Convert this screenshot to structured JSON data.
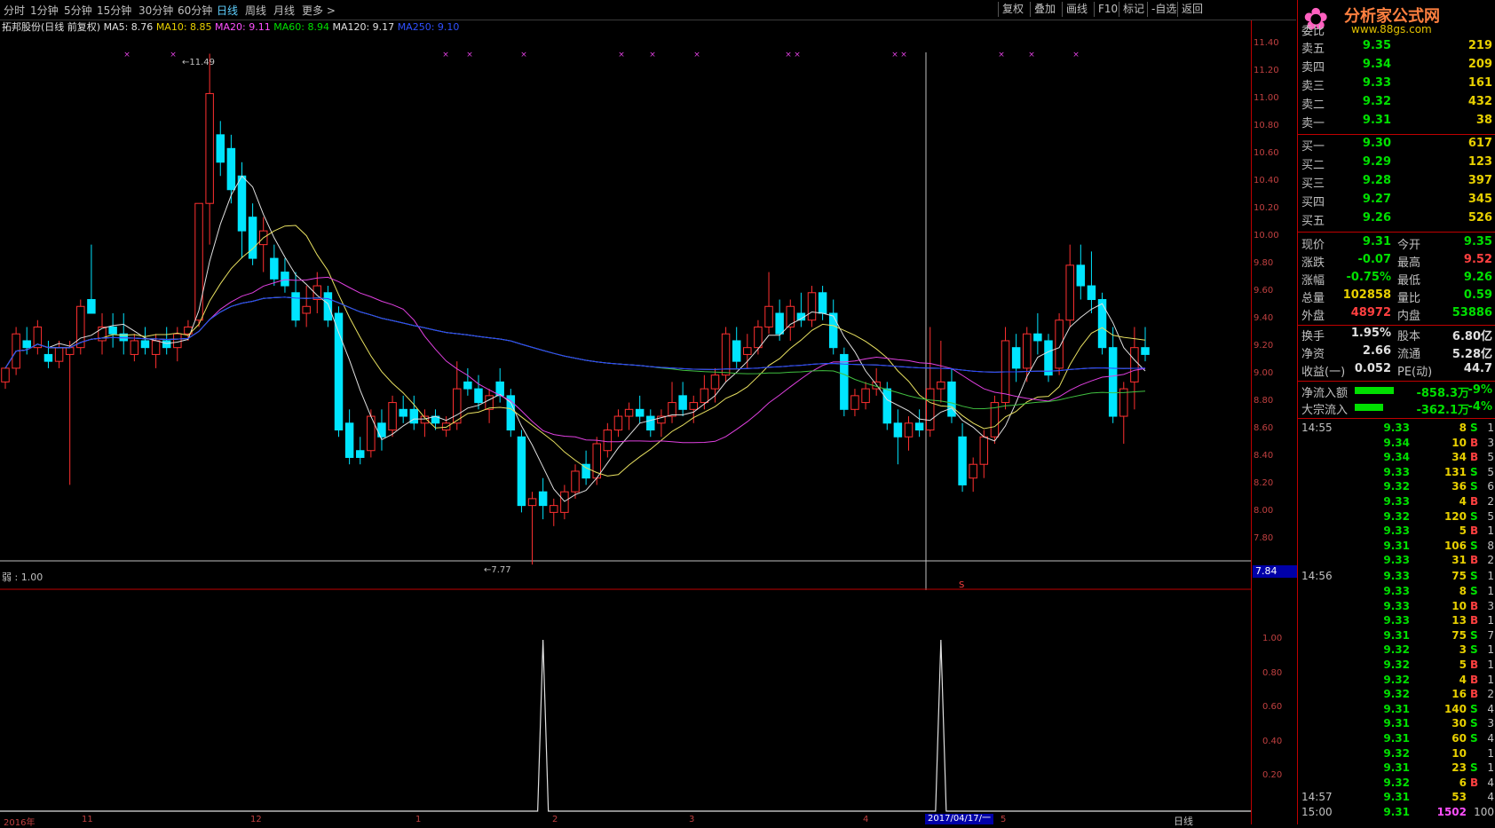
{
  "toolbar": {
    "periods": [
      "分时",
      "1分钟",
      "5分钟",
      "15分钟",
      "30分钟",
      "60分钟",
      "日线",
      "周线",
      "月线",
      "更多 >"
    ],
    "active_period": "日线",
    "buttons": [
      "复权",
      "叠加",
      "画线",
      "F10",
      "标记",
      "-自选",
      "返回"
    ]
  },
  "indicator_header": {
    "stock": "拓邦股份(日线 前复权)",
    "ma5": "MA5: 8.76",
    "ma10": "MA10: 8.85",
    "ma20": "MA20: 9.11",
    "ma60": "MA60: 8.94",
    "ma120": "MA120: 9.17",
    "ma250": "MA250: 9.10"
  },
  "colors": {
    "up": "#ff3030",
    "down": "#00e5ff",
    "ma5": "#e0e0e0",
    "ma10": "#e8e060",
    "ma20": "#e040e0",
    "ma60": "#40c040",
    "ma120": "#d0d0d0",
    "ma250": "#2040ff"
  },
  "main_axis": [
    "11.40",
    "11.20",
    "11.00",
    "10.80",
    "10.60",
    "10.40",
    "10.20",
    "10.00",
    "9.80",
    "9.60",
    "9.40",
    "9.20",
    "9.00",
    "8.80",
    "8.60",
    "8.40",
    "8.20",
    "8.00",
    "7.80"
  ],
  "current_price_box": "7.84",
  "high_label": "11.49",
  "low_label": "7.77",
  "sub_label": "弱 : 1.00",
  "sub_axis": [
    "1.00",
    "0.80",
    "0.60",
    "0.40",
    "0.20"
  ],
  "s_marker": "S",
  "date_labels": [
    "2016年",
    "11",
    "12",
    "1",
    "2",
    "3",
    "4",
    "5"
  ],
  "cursor_date": "2017/04/17/一",
  "bottom_right_label": "日线",
  "logo": {
    "title": "分析家公式网",
    "url": "www.88gs.com"
  },
  "order_book": {
    "header": "委比",
    "asks": [
      {
        "label": "卖五",
        "price": "9.35",
        "vol": "219"
      },
      {
        "label": "卖四",
        "price": "9.34",
        "vol": "209"
      },
      {
        "label": "卖三",
        "price": "9.33",
        "vol": "161"
      },
      {
        "label": "卖二",
        "price": "9.32",
        "vol": "432"
      },
      {
        "label": "卖一",
        "price": "9.31",
        "vol": "38"
      }
    ],
    "bids": [
      {
        "label": "买一",
        "price": "9.30",
        "vol": "617"
      },
      {
        "label": "买二",
        "price": "9.29",
        "vol": "123"
      },
      {
        "label": "买三",
        "price": "9.28",
        "vol": "397"
      },
      {
        "label": "买四",
        "price": "9.27",
        "vol": "345"
      },
      {
        "label": "买五",
        "price": "9.26",
        "vol": "526"
      }
    ]
  },
  "quote": [
    {
      "l1": "现价",
      "v1": "9.31",
      "c1": "green",
      "l2": "今开",
      "v2": "9.35",
      "c2": "green"
    },
    {
      "l1": "涨跌",
      "v1": "-0.07",
      "c1": "green",
      "l2": "最高",
      "v2": "9.52",
      "c2": "red"
    },
    {
      "l1": "涨幅",
      "v1": "-0.75%",
      "c1": "green",
      "l2": "最低",
      "v2": "9.26",
      "c2": "green"
    },
    {
      "l1": "总量",
      "v1": "102858",
      "c1": "yellow",
      "l2": "量比",
      "v2": "0.59",
      "c2": "green"
    },
    {
      "l1": "外盘",
      "v1": "48972",
      "c1": "red",
      "l2": "内盘",
      "v2": "53886",
      "c2": "green"
    },
    {
      "l1": "换手",
      "v1": "1.95%",
      "c1": "white",
      "l2": "股本",
      "v2": "6.80亿",
      "c2": "white"
    },
    {
      "l1": "净资",
      "v1": "2.66",
      "c1": "white",
      "l2": "流通",
      "v2": "5.28亿",
      "c2": "white"
    },
    {
      "l1": "收益(一)",
      "v1": "0.052",
      "c1": "white",
      "l2": "PE(动)",
      "v2": "44.7",
      "c2": "white"
    }
  ],
  "flows": [
    {
      "label": "净流入额",
      "value": "-858.3万",
      "pct": "-9%"
    },
    {
      "label": "大宗流入",
      "value": "-362.1万",
      "pct": "-4%"
    }
  ],
  "ticks": [
    {
      "time": "14:55",
      "price": "9.33",
      "vol": "8",
      "side": "S",
      "n": "1"
    },
    {
      "time": "",
      "price": "9.34",
      "vol": "10",
      "side": "B",
      "n": "3"
    },
    {
      "time": "",
      "price": "9.34",
      "vol": "34",
      "side": "B",
      "n": "5"
    },
    {
      "time": "",
      "price": "9.33",
      "vol": "131",
      "side": "S",
      "n": "5"
    },
    {
      "time": "",
      "price": "9.32",
      "vol": "36",
      "side": "S",
      "n": "6"
    },
    {
      "time": "",
      "price": "9.33",
      "vol": "4",
      "side": "B",
      "n": "2"
    },
    {
      "time": "",
      "price": "9.32",
      "vol": "120",
      "side": "S",
      "n": "5"
    },
    {
      "time": "",
      "price": "9.33",
      "vol": "5",
      "side": "B",
      "n": "1"
    },
    {
      "time": "",
      "price": "9.31",
      "vol": "106",
      "side": "S",
      "n": "8"
    },
    {
      "time": "",
      "price": "9.33",
      "vol": "31",
      "side": "B",
      "n": "2"
    },
    {
      "time": "14:56",
      "price": "9.33",
      "vol": "75",
      "side": "S",
      "n": "1"
    },
    {
      "time": "",
      "price": "9.33",
      "vol": "8",
      "side": "S",
      "n": "1"
    },
    {
      "time": "",
      "price": "9.33",
      "vol": "10",
      "side": "B",
      "n": "3"
    },
    {
      "time": "",
      "price": "9.33",
      "vol": "13",
      "side": "B",
      "n": "1"
    },
    {
      "time": "",
      "price": "9.31",
      "vol": "75",
      "side": "S",
      "n": "7"
    },
    {
      "time": "",
      "price": "9.32",
      "vol": "3",
      "side": "S",
      "n": "1"
    },
    {
      "time": "",
      "price": "9.32",
      "vol": "5",
      "side": "B",
      "n": "1"
    },
    {
      "time": "",
      "price": "9.32",
      "vol": "4",
      "side": "B",
      "n": "1"
    },
    {
      "time": "",
      "price": "9.32",
      "vol": "16",
      "side": "B",
      "n": "2"
    },
    {
      "time": "",
      "price": "9.31",
      "vol": "140",
      "side": "S",
      "n": "4"
    },
    {
      "time": "",
      "price": "9.31",
      "vol": "30",
      "side": "S",
      "n": "3"
    },
    {
      "time": "",
      "price": "9.31",
      "vol": "60",
      "side": "S",
      "n": "4"
    },
    {
      "time": "",
      "price": "9.32",
      "vol": "10",
      "side": "",
      "n": "1"
    },
    {
      "time": "",
      "price": "9.31",
      "vol": "23",
      "side": "S",
      "n": "1"
    },
    {
      "time": "",
      "price": "9.32",
      "vol": "6",
      "side": "B",
      "n": "4"
    },
    {
      "time": "14:57",
      "price": "9.31",
      "vol": "53",
      "side": "",
      "n": "4"
    },
    {
      "time": "15:00",
      "price": "9.31",
      "vol": "1502",
      "side": "",
      "n": "100"
    }
  ],
  "chart_data": {
    "type": "candlestick",
    "ylim": [
      7.7,
      11.5
    ],
    "candles": [
      [
        9.1,
        9.2,
        9.05,
        9.2
      ],
      [
        9.2,
        9.5,
        9.15,
        9.45
      ],
      [
        9.4,
        9.5,
        9.3,
        9.35
      ],
      [
        9.35,
        9.55,
        9.3,
        9.5
      ],
      [
        9.3,
        9.4,
        9.2,
        9.25
      ],
      [
        9.25,
        9.4,
        9.2,
        9.35
      ],
      [
        9.3,
        9.4,
        8.35,
        9.35
      ],
      [
        9.35,
        9.7,
        9.3,
        9.65
      ],
      [
        9.7,
        10.1,
        9.6,
        9.6
      ],
      [
        9.4,
        9.6,
        9.3,
        9.5
      ],
      [
        9.5,
        9.6,
        9.35,
        9.45
      ],
      [
        9.45,
        9.6,
        9.3,
        9.4
      ],
      [
        9.3,
        9.45,
        9.25,
        9.4
      ],
      [
        9.4,
        9.5,
        9.3,
        9.35
      ],
      [
        9.3,
        9.45,
        9.2,
        9.4
      ],
      [
        9.4,
        9.5,
        9.3,
        9.35
      ],
      [
        9.35,
        9.5,
        9.25,
        9.45
      ],
      [
        9.45,
        9.55,
        9.4,
        9.5
      ],
      [
        9.55,
        10.4,
        9.5,
        10.4
      ],
      [
        10.4,
        11.49,
        10.1,
        11.2
      ],
      [
        10.9,
        11.0,
        10.6,
        10.7
      ],
      [
        10.8,
        10.9,
        10.4,
        10.5
      ],
      [
        10.6,
        10.7,
        10.0,
        10.2
      ],
      [
        10.3,
        10.4,
        9.95,
        10.0
      ],
      [
        10.1,
        10.3,
        9.9,
        10.2
      ],
      [
        10.0,
        10.1,
        9.8,
        9.85
      ],
      [
        9.9,
        10.0,
        9.75,
        9.8
      ],
      [
        9.75,
        9.9,
        9.5,
        9.55
      ],
      [
        9.6,
        9.8,
        9.5,
        9.65
      ],
      [
        9.7,
        9.9,
        9.6,
        9.8
      ],
      [
        9.75,
        9.8,
        9.5,
        9.55
      ],
      [
        9.6,
        9.65,
        8.7,
        8.75
      ],
      [
        8.8,
        8.9,
        8.5,
        8.55
      ],
      [
        8.6,
        8.7,
        8.5,
        8.55
      ],
      [
        8.6,
        8.9,
        8.55,
        8.85
      ],
      [
        8.8,
        8.9,
        8.6,
        8.7
      ],
      [
        8.75,
        9.0,
        8.7,
        8.95
      ],
      [
        8.9,
        9.0,
        8.8,
        8.85
      ],
      [
        8.9,
        9.0,
        8.75,
        8.8
      ],
      [
        8.8,
        8.9,
        8.7,
        8.85
      ],
      [
        8.85,
        8.9,
        8.75,
        8.8
      ],
      [
        8.75,
        8.85,
        8.7,
        8.8
      ],
      [
        8.8,
        9.25,
        8.75,
        9.05
      ],
      [
        9.1,
        9.2,
        9.0,
        9.05
      ],
      [
        9.05,
        9.15,
        8.9,
        8.95
      ],
      [
        8.9,
        9.05,
        8.8,
        9.0
      ],
      [
        9.1,
        9.2,
        8.95,
        9.0
      ],
      [
        9.0,
        9.05,
        8.7,
        8.75
      ],
      [
        8.7,
        8.75,
        8.15,
        8.2
      ],
      [
        8.2,
        8.3,
        7.77,
        8.25
      ],
      [
        8.3,
        8.4,
        8.1,
        8.2
      ],
      [
        8.15,
        8.25,
        8.05,
        8.2
      ],
      [
        8.15,
        8.35,
        8.1,
        8.3
      ],
      [
        8.3,
        8.5,
        8.25,
        8.45
      ],
      [
        8.5,
        8.6,
        8.35,
        8.4
      ],
      [
        8.4,
        8.7,
        8.35,
        8.65
      ],
      [
        8.6,
        8.8,
        8.55,
        8.75
      ],
      [
        8.75,
        8.9,
        8.7,
        8.85
      ],
      [
        8.85,
        8.95,
        8.75,
        8.9
      ],
      [
        8.9,
        9.0,
        8.8,
        8.85
      ],
      [
        8.85,
        8.9,
        8.7,
        8.75
      ],
      [
        8.8,
        8.9,
        8.7,
        8.85
      ],
      [
        8.85,
        9.1,
        8.8,
        8.95
      ],
      [
        9.0,
        9.1,
        8.85,
        8.9
      ],
      [
        8.9,
        9.0,
        8.8,
        8.95
      ],
      [
        8.95,
        9.15,
        8.9,
        9.05
      ],
      [
        9.05,
        9.2,
        8.95,
        9.15
      ],
      [
        9.15,
        9.5,
        9.1,
        9.45
      ],
      [
        9.4,
        9.5,
        9.2,
        9.25
      ],
      [
        9.3,
        9.45,
        9.2,
        9.35
      ],
      [
        9.35,
        9.55,
        9.3,
        9.5
      ],
      [
        9.5,
        9.9,
        9.45,
        9.65
      ],
      [
        9.6,
        9.7,
        9.4,
        9.45
      ],
      [
        9.5,
        9.7,
        9.4,
        9.65
      ],
      [
        9.6,
        9.75,
        9.5,
        9.55
      ],
      [
        9.55,
        9.8,
        9.5,
        9.75
      ],
      [
        9.75,
        9.8,
        9.55,
        9.6
      ],
      [
        9.6,
        9.7,
        9.3,
        9.35
      ],
      [
        9.3,
        9.35,
        8.85,
        8.9
      ],
      [
        8.9,
        9.05,
        8.85,
        9.0
      ],
      [
        8.95,
        9.1,
        8.9,
        9.05
      ],
      [
        9.05,
        9.2,
        9.0,
        9.1
      ],
      [
        9.05,
        9.1,
        8.75,
        8.8
      ],
      [
        8.8,
        8.9,
        8.5,
        8.7
      ],
      [
        8.7,
        8.85,
        8.6,
        8.8
      ],
      [
        8.8,
        8.9,
        8.7,
        8.75
      ],
      [
        8.75,
        9.5,
        8.7,
        9.05
      ],
      [
        9.05,
        9.4,
        8.95,
        9.1
      ],
      [
        9.1,
        9.2,
        8.8,
        8.85
      ],
      [
        8.7,
        8.8,
        8.3,
        8.35
      ],
      [
        8.4,
        8.55,
        8.3,
        8.5
      ],
      [
        8.5,
        8.75,
        8.4,
        8.7
      ],
      [
        8.7,
        9.0,
        8.65,
        8.95
      ],
      [
        8.95,
        9.5,
        8.9,
        9.4
      ],
      [
        9.35,
        9.45,
        9.1,
        9.2
      ],
      [
        9.2,
        9.5,
        9.1,
        9.45
      ],
      [
        9.45,
        9.6,
        9.3,
        9.4
      ],
      [
        9.4,
        9.45,
        9.1,
        9.15
      ],
      [
        9.2,
        9.6,
        9.15,
        9.55
      ],
      [
        9.55,
        10.1,
        9.5,
        9.95
      ],
      [
        9.95,
        10.1,
        9.7,
        9.8
      ],
      [
        9.8,
        10.05,
        9.6,
        9.7
      ],
      [
        9.7,
        9.75,
        9.3,
        9.35
      ],
      [
        9.35,
        9.5,
        8.8,
        8.85
      ],
      [
        8.85,
        9.1,
        8.65,
        9.05
      ],
      [
        9.1,
        9.5,
        8.9,
        9.35
      ],
      [
        9.35,
        9.5,
        9.25,
        9.3
      ]
    ],
    "sub_series": {
      "peaks": [
        {
          "index": 50,
          "value": 1.0
        },
        {
          "index": 87,
          "value": 1.0
        }
      ]
    }
  }
}
